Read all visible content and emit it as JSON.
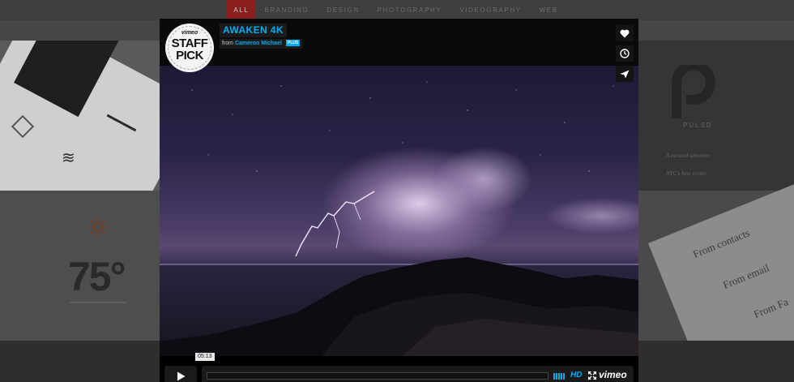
{
  "nav": {
    "items": [
      {
        "label": "ALL",
        "active": true
      },
      {
        "label": "BRANDING",
        "active": false
      },
      {
        "label": "DESIGN",
        "active": false
      },
      {
        "label": "PHOTOGRAPHY",
        "active": false
      },
      {
        "label": "VIDEOGRAPHY",
        "active": false
      },
      {
        "label": "WEB",
        "active": false
      }
    ]
  },
  "background": {
    "weather": {
      "temp": "75°",
      "icon": "sun-icon"
    },
    "pulsd": {
      "name": "PULSD",
      "line1": "A curated selection",
      "line2": "NYC's best events"
    },
    "contacts": [
      "From contacts",
      "From email",
      "From Fa"
    ]
  },
  "video": {
    "badge": {
      "brand": "vimeo",
      "line1": "STAFF",
      "line2": "PICK"
    },
    "title": "AWAKEN 4K",
    "byline_prefix": "from",
    "author": "Cameron Michael",
    "plus_label": "PLUS",
    "side_buttons": [
      "heart-icon",
      "clock-icon",
      "paper-plane-icon"
    ]
  },
  "player": {
    "timecode": "05:13",
    "progress": 0.0,
    "hd_label": "HD",
    "logo": "vimeo",
    "accent_color": "#00adef"
  }
}
